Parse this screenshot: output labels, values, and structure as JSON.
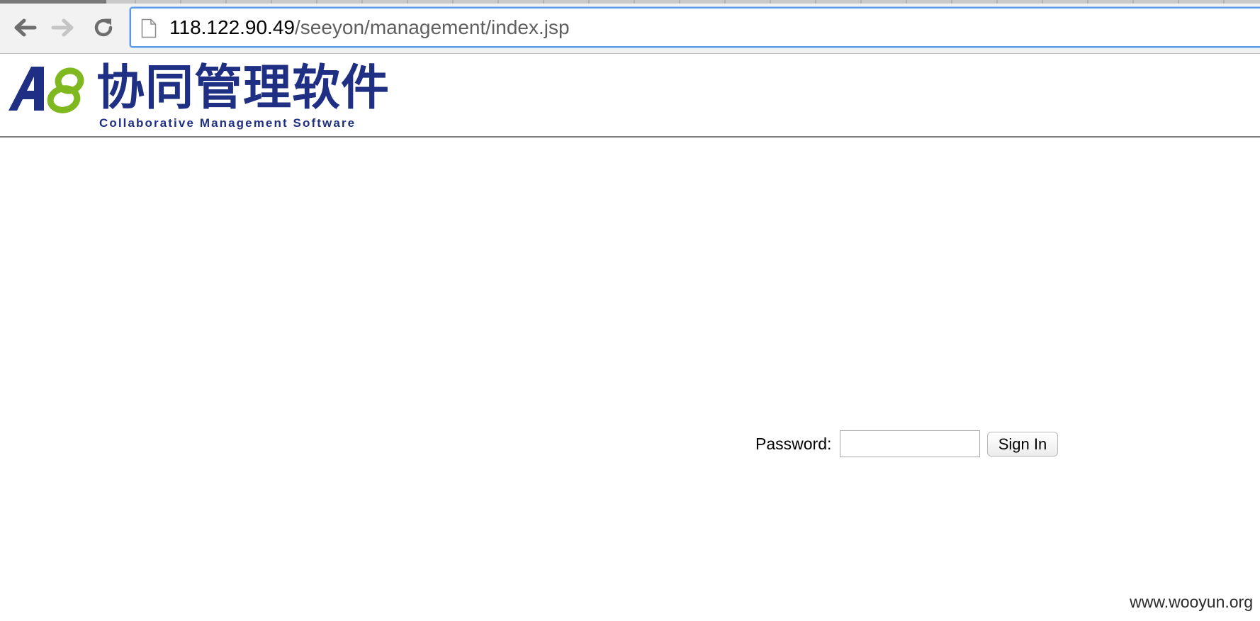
{
  "browser": {
    "url_host": "118.122.90.49",
    "url_path": "/seeyon/management/index.jsp",
    "icons": {
      "back": "back-arrow-icon",
      "forward": "forward-arrow-icon",
      "reload": "reload-icon",
      "page": "page-icon"
    }
  },
  "header": {
    "logo_mark": "A8",
    "logo_cn": "协同管理软件",
    "logo_en": "Collaborative Management Software",
    "colors": {
      "brand_blue": "#1f2f83",
      "brand_green": "#7fb81f"
    }
  },
  "login": {
    "password_label": "Password:",
    "password_value": "",
    "signin_label": "Sign In"
  },
  "watermark": "www.wooyun.org"
}
